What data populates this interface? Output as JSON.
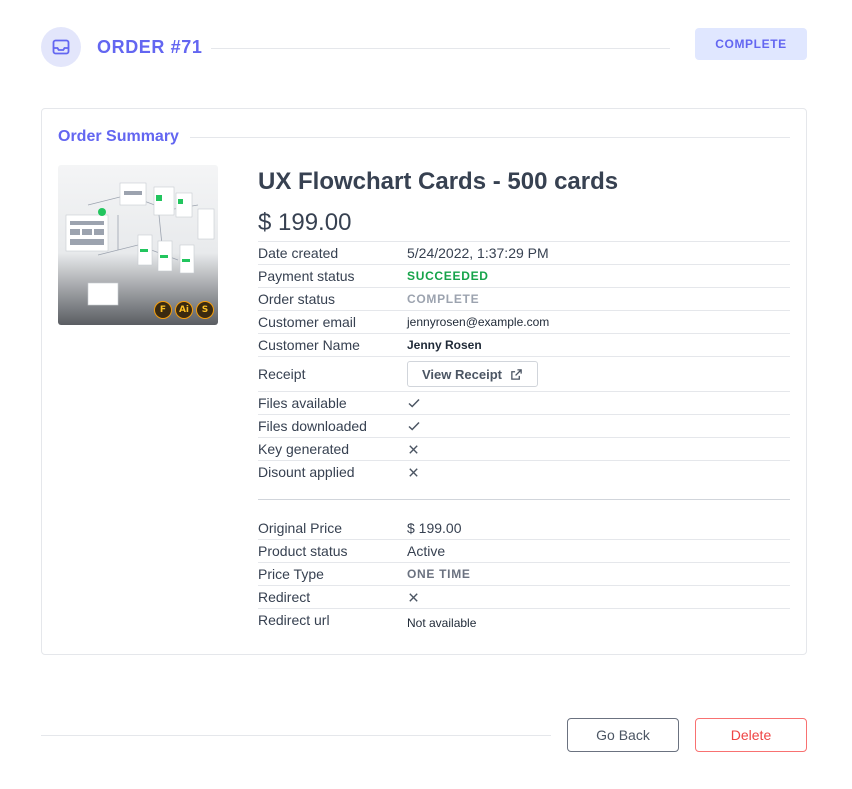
{
  "header": {
    "title": "ORDER #71",
    "status": "COMPLETE",
    "icon": "inbox-icon"
  },
  "summary": {
    "title": "Order Summary",
    "product_name": "UX Flowchart Cards - 500 cards",
    "price": "$ 199.00",
    "image_icons": [
      "F",
      "Ai",
      "S"
    ]
  },
  "details": {
    "date_created": {
      "label": "Date created",
      "value": "5/24/2022, 1:37:29 PM"
    },
    "payment_status": {
      "label": "Payment status",
      "value": "SUCCEEDED"
    },
    "order_status": {
      "label": "Order status",
      "value": "COMPLETE"
    },
    "customer_email": {
      "label": "Customer email",
      "value": "jennyrosen@example.com"
    },
    "customer_name": {
      "label": "Customer Name",
      "value": "Jenny Rosen"
    },
    "receipt": {
      "label": "Receipt",
      "button": "View Receipt"
    },
    "files_available": {
      "label": "Files available",
      "value": "check-icon"
    },
    "files_downloaded": {
      "label": "Files downloaded",
      "value": "check-icon"
    },
    "key_generated": {
      "label": "Key generated",
      "value": "x-icon"
    },
    "discount_applied": {
      "label": "Disount applied",
      "value": "x-icon"
    }
  },
  "product": {
    "original_price": {
      "label": "Original Price",
      "value": "$ 199.00"
    },
    "product_status": {
      "label": "Product status",
      "value": "Active"
    },
    "price_type": {
      "label": "Price Type",
      "value": "ONE TIME"
    },
    "redirect": {
      "label": "Redirect",
      "value": "x-icon"
    },
    "redirect_url": {
      "label": "Redirect url",
      "value": "Not available"
    }
  },
  "footer": {
    "back_label": "Go Back",
    "delete_label": "Delete"
  },
  "colors": {
    "accent": "#6366f1",
    "success": "#16a34a",
    "danger": "#ef4444",
    "muted": "#9ca3af"
  }
}
